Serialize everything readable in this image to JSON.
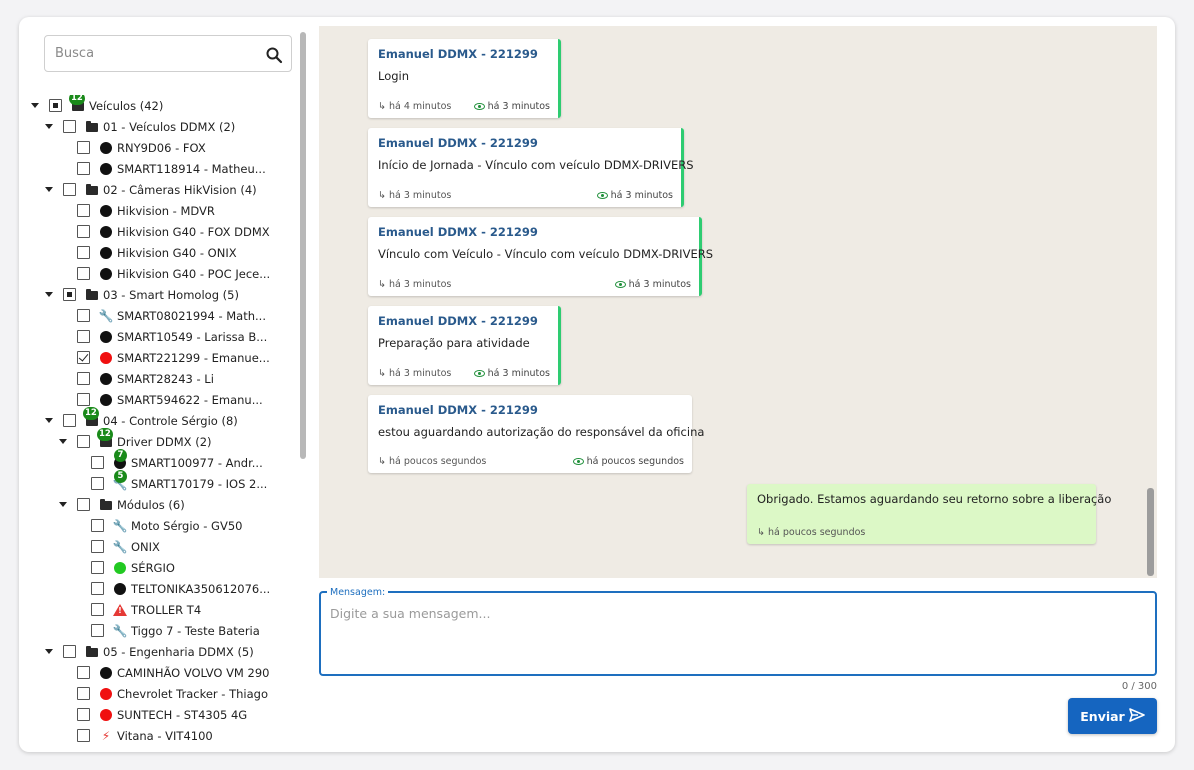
{
  "search": {
    "placeholder": "Busca"
  },
  "tree": {
    "root_label": "Veículos (42)",
    "root_badge": "12",
    "g1_label": "01 - Veículos DDMX (2)",
    "g1_i1": "RNY9D06 - FOX",
    "g1_i2": "SMART118914 - Matheu...",
    "g2_label": "02 - Câmeras HikVision (4)",
    "g2_i1": "Hikvision - MDVR",
    "g2_i2": "Hikvision G40 - FOX DDMX",
    "g2_i3": "Hikvision G40 - ONIX",
    "g2_i4": "Hikvision G40 - POC Jece...",
    "g3_label": "03 - Smart Homolog (5)",
    "g3_i1": "SMART08021994 - Math...",
    "g3_i2": "SMART10549 - Larissa B...",
    "g3_i3": "SMART221299 - Emanue...",
    "g3_i4": "SMART28243 - Li",
    "g3_i5": "SMART594622 - Emanu...",
    "g4_label": "04 - Controle Sérgio (8)",
    "g4_badge": "12",
    "g4a_label": "Driver DDMX (2)",
    "g4a_badge": "12",
    "g4a_i1": "SMART100977 - Andr...",
    "g4a_i1_badge": "7",
    "g4a_i2": "SMART170179 - IOS 2...",
    "g4a_i2_badge": "5",
    "g4b_label": "Módulos (6)",
    "g4b_i1": "Moto Sérgio - GV50",
    "g4b_i2": "ONIX",
    "g4b_i3": "SÉRGIO",
    "g4b_i4": "TELTONIKA350612076...",
    "g4b_i5": "TROLLER T4",
    "g4b_i6": "Tiggo 7 - Teste Bateria",
    "g5_label": "05 - Engenharia DDMX (5)",
    "g5_i1": "CAMINHÃO VOLVO VM 290",
    "g5_i2": "Chevrolet Tracker - Thiago",
    "g5_i3": "SUNTECH - ST4305 4G",
    "g5_i4": "Vitana - VIT4100"
  },
  "messages": [
    {
      "author": "Emanuel DDMX - 221299",
      "text": "Login",
      "sent": "há 4 minutos",
      "seen": "há 3 minutos"
    },
    {
      "author": "Emanuel DDMX - 221299",
      "text": "Início de Jornada - Vínculo com veículo DDMX-DRIVERS",
      "sent": "há 3 minutos",
      "seen": "há 3 minutos"
    },
    {
      "author": "Emanuel DDMX - 221299",
      "text": "Vínculo com Veículo - Vínculo com veículo DDMX-DRIVERS",
      "sent": "há 3 minutos",
      "seen": "há 3 minutos"
    },
    {
      "author": "Emanuel DDMX - 221299",
      "text": "Preparação para atividade",
      "sent": "há 3 minutos",
      "seen": "há 3 minutos"
    },
    {
      "author": "Emanuel DDMX - 221299",
      "text": "estou aguardando autorização do responsável da oficina",
      "sent": "há poucos segundos",
      "seen": "há poucos segundos"
    }
  ],
  "own_message": {
    "text": "Obrigado. Estamos aguardando seu retorno sobre a liberação",
    "sent": "há poucos segundos"
  },
  "compose": {
    "label": "Mensagem:",
    "placeholder": "Digite a sua mensagem...",
    "counter": "0 / 300",
    "send_label": "Enviar"
  },
  "colors": {
    "accent": "#1565c0",
    "author": "#2a5a8c",
    "seen_edge": "#2ecc71",
    "own_bubble": "#dcf8c6",
    "chat_bg": "#efebe4",
    "badge": "#1a8a1a"
  }
}
